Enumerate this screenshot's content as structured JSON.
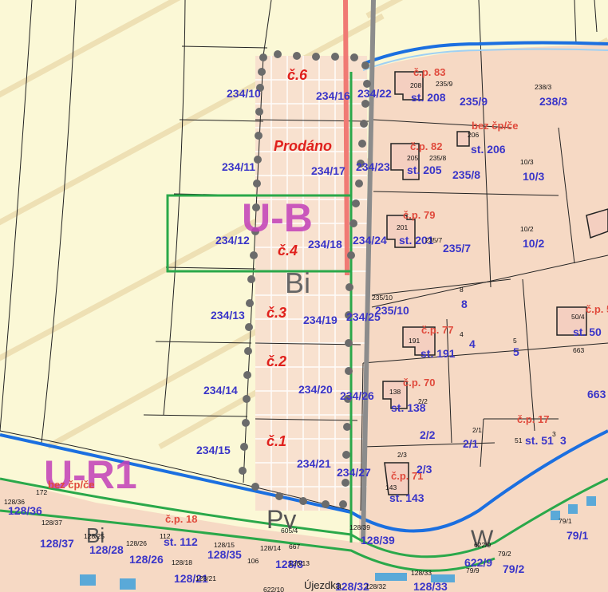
{
  "zones": {
    "ub": "U-B",
    "bi": "Bi",
    "ur1": "U-R1",
    "pv": "Pv",
    "bi_small": "Bi",
    "w": "W"
  },
  "lots": {
    "c6": "č.6",
    "prodano": "Prodáno",
    "c4": "č.4",
    "c3": "č.3",
    "c2": "č.2",
    "c1": "č.1"
  },
  "house_numbers": {
    "cp83": "č.p. 83",
    "cp82": "č.p. 82",
    "bez": "bez čp/če",
    "cp79": "č.p. 79",
    "cp77": "č.p. 77",
    "cp70": "č.p. 70",
    "cp71": "č.p. 71",
    "cp17": "č.p. 17",
    "cp18": "č.p. 18",
    "cp5": "č.p. 5",
    "bez2": "bez čp/če"
  },
  "parcels": {
    "p234_10": "234/10",
    "p234_16": "234/16",
    "p234_22": "234/22",
    "p234_11": "234/11",
    "p234_17": "234/17",
    "p234_23": "234/23",
    "p234_12": "234/12",
    "p234_18": "234/18",
    "p234_24": "234/24",
    "p234_13": "234/13",
    "p234_19": "234/19",
    "p234_25": "234/25",
    "p234_14": "234/14",
    "p234_20": "234/20",
    "p234_26": "234/26",
    "p234_15": "234/15",
    "p234_21": "234/21",
    "p234_27": "234/27",
    "st208": "st. 208",
    "p235_9": "235/9",
    "p238_3": "238/3",
    "st205": "st. 205",
    "p235_8": "235/8",
    "st206": "st. 206",
    "p10_3": "10/3",
    "st201": "st. 201",
    "p235_7": "235/7",
    "p10_2": "10/2",
    "p235_10": "235/10",
    "p8": "8",
    "st191": "st. 191",
    "p4": "4",
    "p5": "5",
    "st50": "st. 50",
    "p663": "663",
    "st138": "st. 138",
    "p2_2": "2/2",
    "p2_1": "2/1",
    "st51": "st. 51",
    "p3": "3",
    "p2_3": "2/3",
    "st143": "st. 143",
    "p128_39": "128/39",
    "p79_1": "79/1",
    "p79_2": "79/2",
    "p622_9": "622/9",
    "p128_37": "128/37",
    "p128_28": "128/28",
    "p128_26": "128/26",
    "st112": "st. 112",
    "p128_33": "128/33",
    "p128_21": "128/21",
    "p128_3": "128/3",
    "p128_36": "128/36",
    "p128_35": "128/35",
    "p128_32": "128/32"
  },
  "small_labels": {
    "s208": "208",
    "s235_9": "235/9",
    "s238_3": "238/3",
    "s206": "206",
    "s205": "205",
    "s235_8": "235/8",
    "s10_3": "10/3",
    "s201": "201",
    "s235_7": "235/7",
    "s10_2": "10/2",
    "s235_10": "235/10",
    "s8": "8",
    "s191": "191",
    "s4": "4",
    "s5": "5",
    "s50_4": "50/4",
    "s663": "663",
    "s138": "138",
    "s2_2": "2/2",
    "s2_1": "2/1",
    "s51": "51",
    "s3": "3",
    "s2_3": "2/3",
    "s143": "143",
    "s128_39": "128/39",
    "s605_4": "605/4",
    "s79_1": "79/1",
    "s79_2": "79/2",
    "s79_9": "79/9",
    "s622_9": "622/9",
    "s128_36": "128/36",
    "s172": "172",
    "s128_37": "128/37",
    "s128_25": "128/25",
    "s128_26": "128/26",
    "s112": "112",
    "s128_15": "128/15",
    "s128_14": "128/14",
    "s106": "106",
    "s128_18": "128/18",
    "s128_13": "128/13",
    "s128_21": "128/21",
    "s128_33": "128/33",
    "s128_32": "128/32",
    "s667": "667",
    "s622_10": "622/10"
  },
  "street": "Újezdka",
  "colors": {
    "field": "#fbf8d6",
    "built": "#f6d9c4",
    "plot_fill": "#f7e0cf",
    "zone_label": "#c23fb8",
    "lot_label": "#e0201c",
    "parcel_label": "#3a35c8",
    "green_line": "#2aa84a",
    "blue_line": "#1b6fe0",
    "red_line": "#f07a74",
    "dots": "#6b6b6b"
  }
}
